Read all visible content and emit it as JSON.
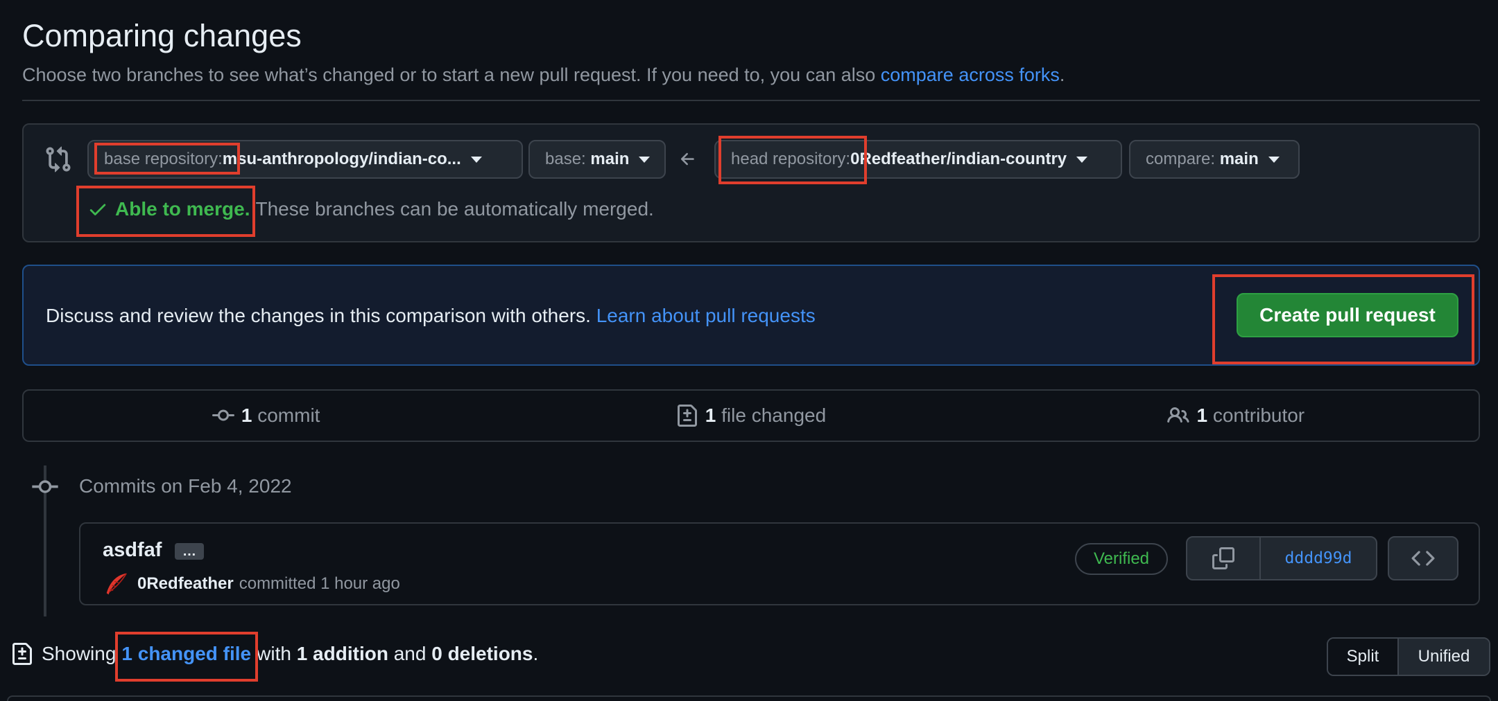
{
  "header": {
    "title": "Comparing changes",
    "subtitle": "Choose two branches to see what’s changed or to start a new pull request. If you need to, you can also ",
    "subtitle_link": "compare across forks",
    "subtitle_end": "."
  },
  "range": {
    "base_repo_label": "base repository:",
    "base_repo_value": "msu-anthropology/indian-co...",
    "base_label": "base:",
    "base_value": "main",
    "head_repo_label": "head repository:",
    "head_repo_value": "0Redfeather/indian-country",
    "compare_label": "compare:",
    "compare_value": "main",
    "merge_ok": "Able to merge.",
    "merge_text": "These branches can be automatically merged."
  },
  "banner": {
    "text": "Discuss and review the changes in this comparison with others. ",
    "link": "Learn about pull requests",
    "button": "Create pull request"
  },
  "stats": {
    "commits_count": "1",
    "commits_label": "commit",
    "files_count": "1",
    "files_label": "file changed",
    "contributors_count": "1",
    "contributors_label": "contributor"
  },
  "commits": {
    "date_header": "Commits on Feb 4, 2022",
    "title": "asdfaf",
    "ellipsis": "…",
    "author": "0Redfeather",
    "meta": "committed 1 hour ago",
    "verified": "Verified",
    "sha": "dddd99d"
  },
  "showing": {
    "prefix": "Showing",
    "link": "1 changed file",
    "with": "with",
    "additions": "1 addition",
    "and": "and",
    "deletions": "0 deletions",
    "end": "."
  },
  "diff_view": {
    "split": "Split",
    "unified": "Unified"
  },
  "colors": {
    "highlight": "#e03e2d",
    "accent_link": "#4493f8",
    "success": "#3fb950",
    "button_green": "#238636"
  }
}
